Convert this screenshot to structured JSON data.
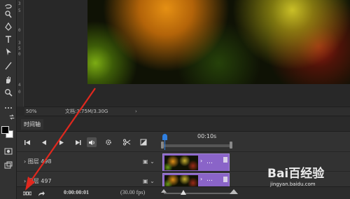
{
  "status_bar": {
    "zoom": "50%",
    "doc_info": "文档:3.75M/3.30G",
    "arrow": "›"
  },
  "vertical_ruler": [
    "3",
    "5",
    "0",
    "3",
    "5",
    "0",
    "4",
    "0"
  ],
  "timeline": {
    "tab_label": "时间轴",
    "time_label": "00:10s",
    "layers": [
      {
        "name": "图层 498",
        "clip_menu": "…",
        "clip_arrow": "›"
      },
      {
        "name": "图层 497",
        "clip_menu": "…",
        "clip_arrow": "›"
      }
    ],
    "timecode": "0:00:00:01",
    "fps": "(30.00 fps)"
  },
  "watermark": {
    "brand": "Bai百经验",
    "url": "jingyan.baidu.com"
  },
  "colors": {
    "playhead": "#2f7fe0",
    "clip": "#8a64c8",
    "annotation": "#e0281e"
  }
}
